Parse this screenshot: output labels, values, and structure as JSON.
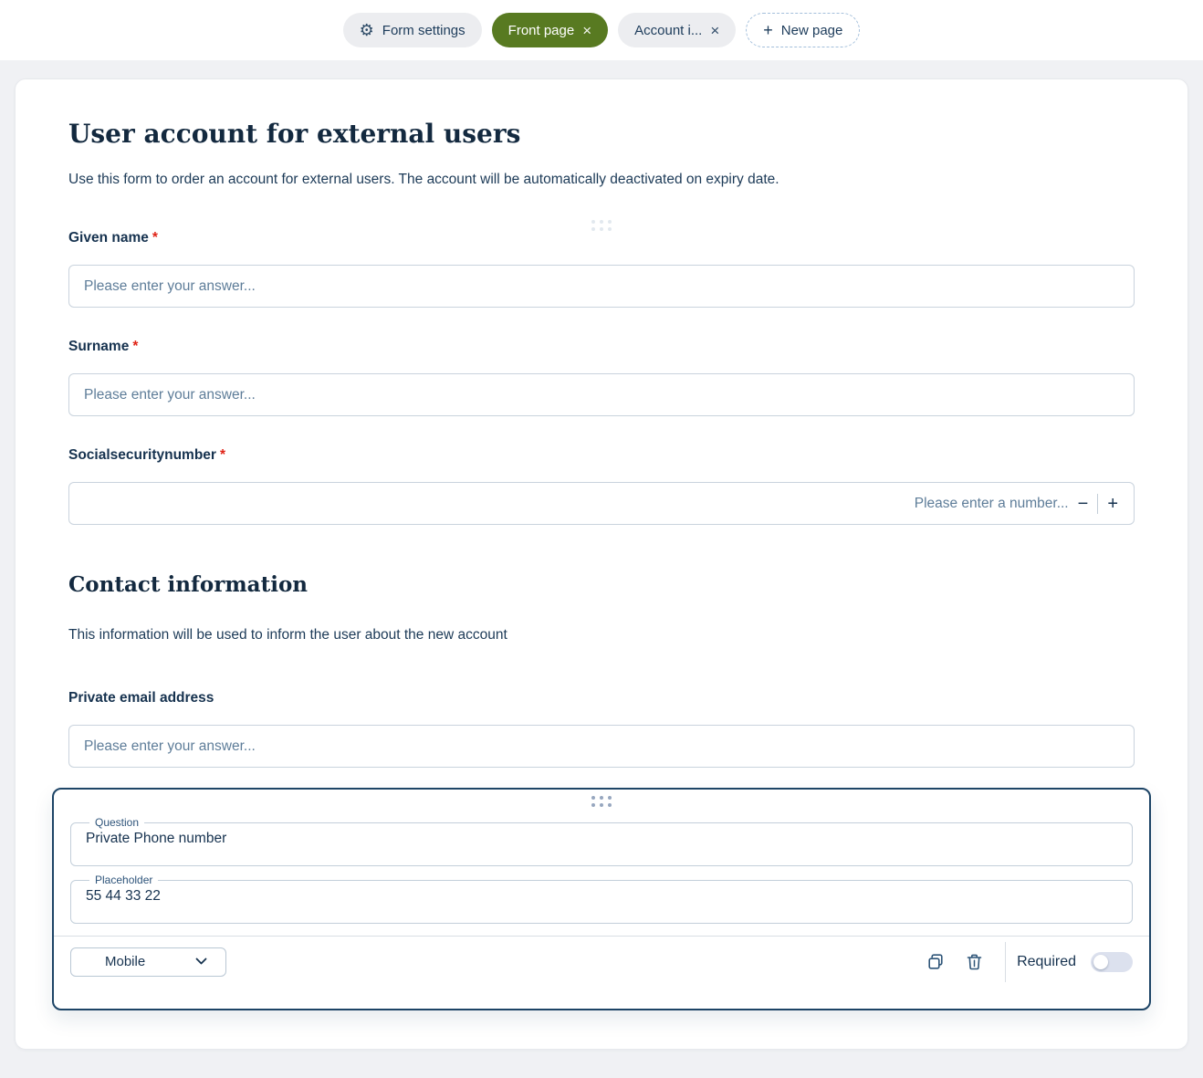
{
  "topbar": {
    "form_settings": {
      "label": "Form settings"
    },
    "tabs": [
      {
        "label": "Front page",
        "close": "×",
        "active": true
      },
      {
        "label": "Account i...",
        "close": "×",
        "active": false
      }
    ],
    "new_page": {
      "plus": "+",
      "label": "New page"
    }
  },
  "page": {
    "title": "User account for external users",
    "description": "Use this form to order an account for external users. The account will be automatically deactivated on expiry date."
  },
  "fields": {
    "given_name": {
      "label": "Given name",
      "required_mark": "*",
      "placeholder": "Please enter your answer..."
    },
    "surname": {
      "label": "Surname",
      "required_mark": "*",
      "placeholder": "Please enter your answer..."
    },
    "social_security_number": {
      "label": "Socialsecuritynumber",
      "required_mark": "*",
      "placeholder": "Please enter a number...",
      "minus": "−",
      "plus": "+"
    },
    "private_email": {
      "label": "Private email address",
      "placeholder": "Please enter your answer..."
    }
  },
  "section": {
    "heading": "Contact information",
    "description": "This information will be used to inform the user about the new account"
  },
  "question_editor": {
    "question": {
      "label": "Question",
      "value": "Private Phone number"
    },
    "placeholder": {
      "label": "Placeholder",
      "value": "55 44 33 22"
    },
    "type_select": {
      "value": "Mobile"
    },
    "required": {
      "label": "Required",
      "enabled": false
    }
  },
  "colors": {
    "active_tab_green": "#587a21",
    "selected_block_border": "#1d4466",
    "required_asterisk_red": "#e02417",
    "text_navy": "#16324f",
    "page_background": "#f0f1f4"
  }
}
